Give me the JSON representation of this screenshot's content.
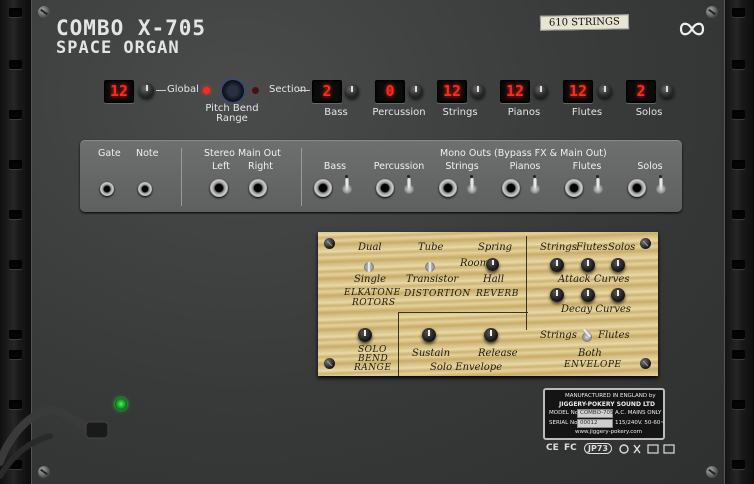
{
  "device": {
    "model_line1": "COMBO X-705",
    "model_line2": "SPACE ORGAN",
    "strip_label": "610 STRINGS",
    "logo": "infinity-icon"
  },
  "top_controls": {
    "global_display": "12",
    "global_label": "Global",
    "pitch_bend_label": "Pitch Bend Range",
    "section_label": "Section",
    "sections": [
      {
        "name": "Bass",
        "value": "2"
      },
      {
        "name": "Percussion",
        "value": "0"
      },
      {
        "name": "Strings",
        "value": "12"
      },
      {
        "name": "Pianos",
        "value": "12"
      },
      {
        "name": "Flutes",
        "value": "12"
      },
      {
        "name": "Solos",
        "value": "2"
      }
    ]
  },
  "jacks": {
    "gate_label": "Gate",
    "note_label": "Note",
    "stereo_label": "Stereo Main Out",
    "left_label": "Left",
    "right_label": "Right",
    "mono_label": "Mono Outs (Bypass FX & Main Out)",
    "mono_outs": [
      "Bass",
      "Percussion",
      "Strings",
      "Pianos",
      "Flutes",
      "Solos"
    ]
  },
  "wood_panel": {
    "rotor": {
      "top": "Dual",
      "bottom": "Single",
      "title1": "ELKATONE",
      "title2": "ROTORS"
    },
    "distortion": {
      "top": "Tube",
      "bottom": "Transistor",
      "title": "DISTORTION"
    },
    "reverb": {
      "top": "Spring",
      "left": "Room",
      "bottom": "Hall",
      "title": "REVERB"
    },
    "curves": {
      "strings": "Strings",
      "flutes": "Flutes",
      "solos": "Solos",
      "attack": "Attack Curves",
      "decay": "Decay Curves"
    },
    "solo_bend": {
      "line1": "SOLO",
      "line2": "BEND",
      "line3": "RANGE"
    },
    "envelope": {
      "sustain": "Sustain",
      "release": "Release",
      "title": "Solo Envelope"
    },
    "envelope_switch": {
      "left": "Strings",
      "right": "Flutes",
      "bottom": "Both",
      "title": "ENVELOPE"
    }
  },
  "plate": {
    "line1": "MANUFACTURED IN ENGLAND by",
    "line2": "JIGGERY-POKERY SOUND LTD",
    "model_label": "MODEL No",
    "model_value": "COMBO-705",
    "mains": "A.C. MAINS ONLY",
    "serial_label": "SERIAL No",
    "serial_value": "00012",
    "voltage": "115/240V. 50-60~",
    "website": "www.jiggery-pokery.com"
  },
  "certifications": [
    "CE",
    "FC",
    "JP73"
  ],
  "colors": {
    "led": "#ff2a1a",
    "panel": "#3a3c3c",
    "wood": "#dcc890",
    "green_led": "#3cff5a"
  }
}
